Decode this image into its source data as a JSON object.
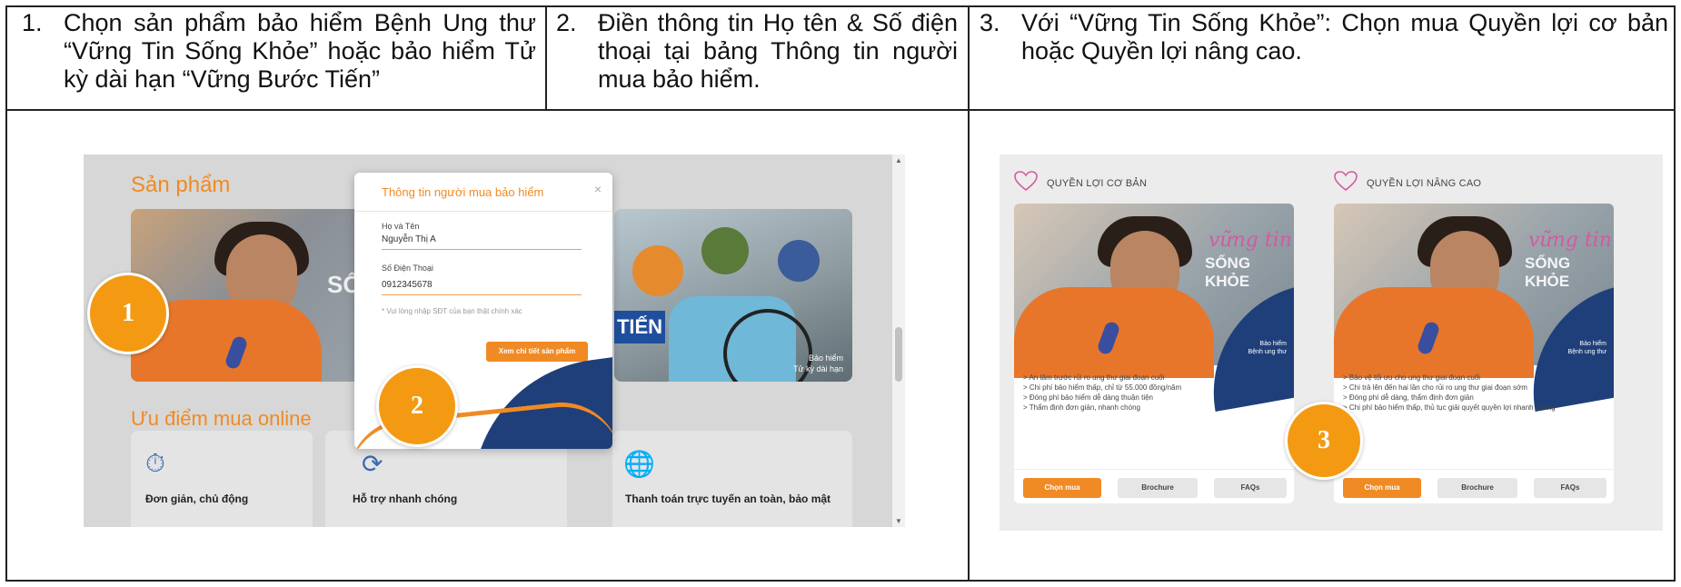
{
  "steps": [
    {
      "num": "1.",
      "text": "Chọn sản phẩm bảo hiểm Bệnh Ung thư “Vững Tin Sống Khỏe” hoặc bảo hiểm Tử kỳ dài hạn “Vững Bước Tiến”"
    },
    {
      "num": "2.",
      "text": "Điền thông tin Họ tên & Số điện thoại tại bảng Thông tin người mua bảo hiểm."
    },
    {
      "num": "3.",
      "text": "Với “Vững Tin Sống Khỏe”: Chọn mua Quyền lợi cơ bản hoặc Quyền lợi nâng cao."
    }
  ],
  "left_screen": {
    "products_title": "Sản phẩm",
    "banner1_text": "SỐ",
    "banner2_tag": "TIẾN",
    "banner2_caption_1": "Bảo hiểm",
    "banner2_caption_2": "Tử kỳ dài hạn",
    "advantages_title": "Ưu điểm mua online",
    "cards": [
      {
        "icon": "clock-check-icon",
        "label": "Đơn giản, chủ động"
      },
      {
        "icon": "support-icon",
        "label": "Hỗ trợ nhanh chóng"
      },
      {
        "icon": "globe-icon",
        "label": "Thanh toán trực tuyến an toàn, bảo mật"
      }
    ],
    "popup": {
      "title": "Thông tin người mua bảo hiểm",
      "close": "×",
      "name_label": "Họ và Tên",
      "name_value": "Nguyễn Thị A",
      "phone_label": "Số Điện Thoại",
      "phone_value": "0912345678",
      "hint": "* Vui lòng nhập SĐT của bạn thật chính xác",
      "button": "Xem chi tiết sản phẩm"
    },
    "badges": [
      "1",
      "2"
    ]
  },
  "right_screen": {
    "columns": [
      {
        "heading": "QUYỀN LỢI CƠ BẢN",
        "script": "vững tin",
        "brand": "SỐNG KHỎE",
        "caption_1": "Bảo hiểm",
        "caption_2": "Bệnh ung thư",
        "bullets": [
          "> An tâm trước rủi ro ung thư giai đoạn cuối",
          "> Chi phí bảo hiểm thấp, chỉ từ 55.000 đồng/năm",
          "> Đóng phí bảo hiểm dễ dàng thuận tiện",
          "> Thẩm định đơn giản, nhanh chóng"
        ],
        "buttons": [
          "Chọn mua",
          "Brochure",
          "FAQs"
        ]
      },
      {
        "heading": "QUYỀN LỢI NÂNG CAO",
        "script": "vững tin",
        "brand": "SỐNG KHỎE",
        "caption_1": "Bảo hiểm",
        "caption_2": "Bệnh ung thư",
        "bullets": [
          "> Bảo vệ tối ưu cho ung thư giai đoạn cuối",
          "> Chi trả lên đến hai lần cho rủi ro ung thư giai đoạn sớm",
          "> Đóng phí dễ dàng, thẩm định đơn giản",
          "> Chi phí bảo hiểm thấp, thủ tục giải quyết quyền lợi nhanh chóng"
        ],
        "buttons": [
          "Chọn mua",
          "Brochure",
          "FAQs"
        ]
      }
    ],
    "badge": "3"
  },
  "colors": {
    "accent_orange": "#f08a24",
    "badge_orange": "#f39a12",
    "navy": "#1f3f7a"
  }
}
